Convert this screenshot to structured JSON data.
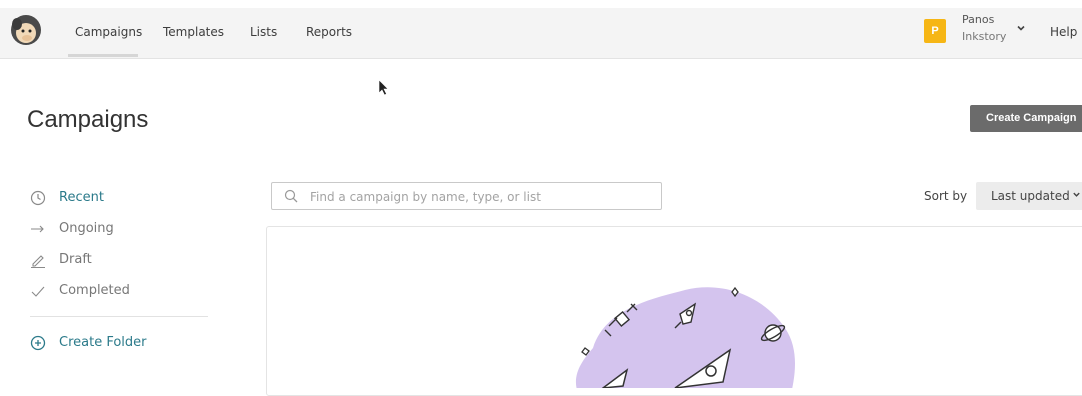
{
  "nav": {
    "items": [
      {
        "label": "Campaigns",
        "active": true
      },
      {
        "label": "Templates"
      },
      {
        "label": "Lists"
      },
      {
        "label": "Reports"
      }
    ],
    "account": {
      "avatar_letter": "P",
      "name": "Panos",
      "org": "Inkstory"
    },
    "help_label": "Help"
  },
  "page": {
    "title": "Campaigns",
    "create_button": "Create Campaign"
  },
  "sidebar": {
    "items": [
      {
        "label": "Recent",
        "icon": "clock-icon",
        "active": true
      },
      {
        "label": "Ongoing",
        "icon": "arrow-right-icon"
      },
      {
        "label": "Draft",
        "icon": "pencil-icon"
      },
      {
        "label": "Completed",
        "icon": "checkmark-icon"
      }
    ],
    "create_folder": "Create Folder"
  },
  "search": {
    "placeholder": "Find a campaign by name, type, or list",
    "value": ""
  },
  "sort": {
    "label": "Sort by",
    "value": "Last updated"
  },
  "colors": {
    "accent": "#2b7a8a",
    "avatar": "#f6b615",
    "button": "#6b6b6b",
    "illustration": "#d4c4ee"
  }
}
